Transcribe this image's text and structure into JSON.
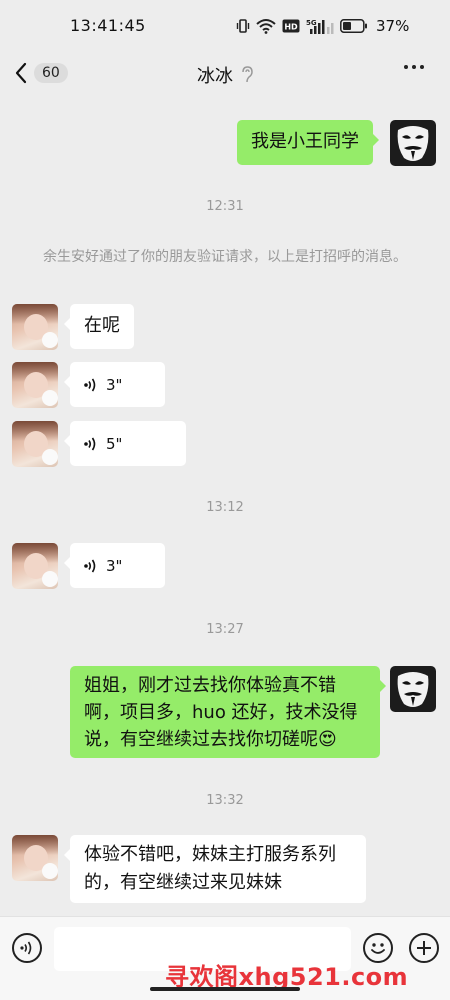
{
  "status_bar": {
    "time": "13:41:45",
    "battery": "37%",
    "network_label": "5G"
  },
  "header": {
    "back_icon": "chevron-left-icon",
    "unread_count": "60",
    "title": "冰冰",
    "title_icon": "ear-icon",
    "more_icon": "more-dots-icon"
  },
  "messages": [
    {
      "type": "text",
      "side": "right",
      "text": "我是小王同学"
    },
    {
      "type": "time",
      "text": "12:31"
    },
    {
      "type": "system",
      "text": "余生安好通过了你的朋友验证请求，以上是打招呼的消息。"
    },
    {
      "type": "text",
      "side": "left",
      "text": "在呢"
    },
    {
      "type": "voice",
      "side": "left",
      "duration": "3\""
    },
    {
      "type": "voice",
      "side": "left",
      "duration": "5\""
    },
    {
      "type": "time",
      "text": "13:12"
    },
    {
      "type": "voice",
      "side": "left",
      "duration": "3\""
    },
    {
      "type": "time",
      "text": "13:27"
    },
    {
      "type": "text",
      "side": "right",
      "line1": "姐姐，刚才过去找你体验真不错",
      "line2": "啊，项目多，huo 还好，技术没得",
      "line3": "说，有空继续过去找你切磋呢😍"
    },
    {
      "type": "time",
      "text": "13:32"
    },
    {
      "type": "text",
      "side": "left",
      "line1": "体验不错吧，妹妹主打服务系列",
      "line2": "的，有空继续过来见妹妹"
    }
  ],
  "input_bar": {
    "voice_icon": "voice-icon",
    "emoji_icon": "emoji-icon",
    "plus_icon": "plus-icon",
    "watermark": "寻欢阁xhg521.com"
  },
  "colors": {
    "background": "#ededed",
    "outgoing_bubble": "#95ec69",
    "incoming_bubble": "#ffffff",
    "watermark": "#e8343a"
  }
}
